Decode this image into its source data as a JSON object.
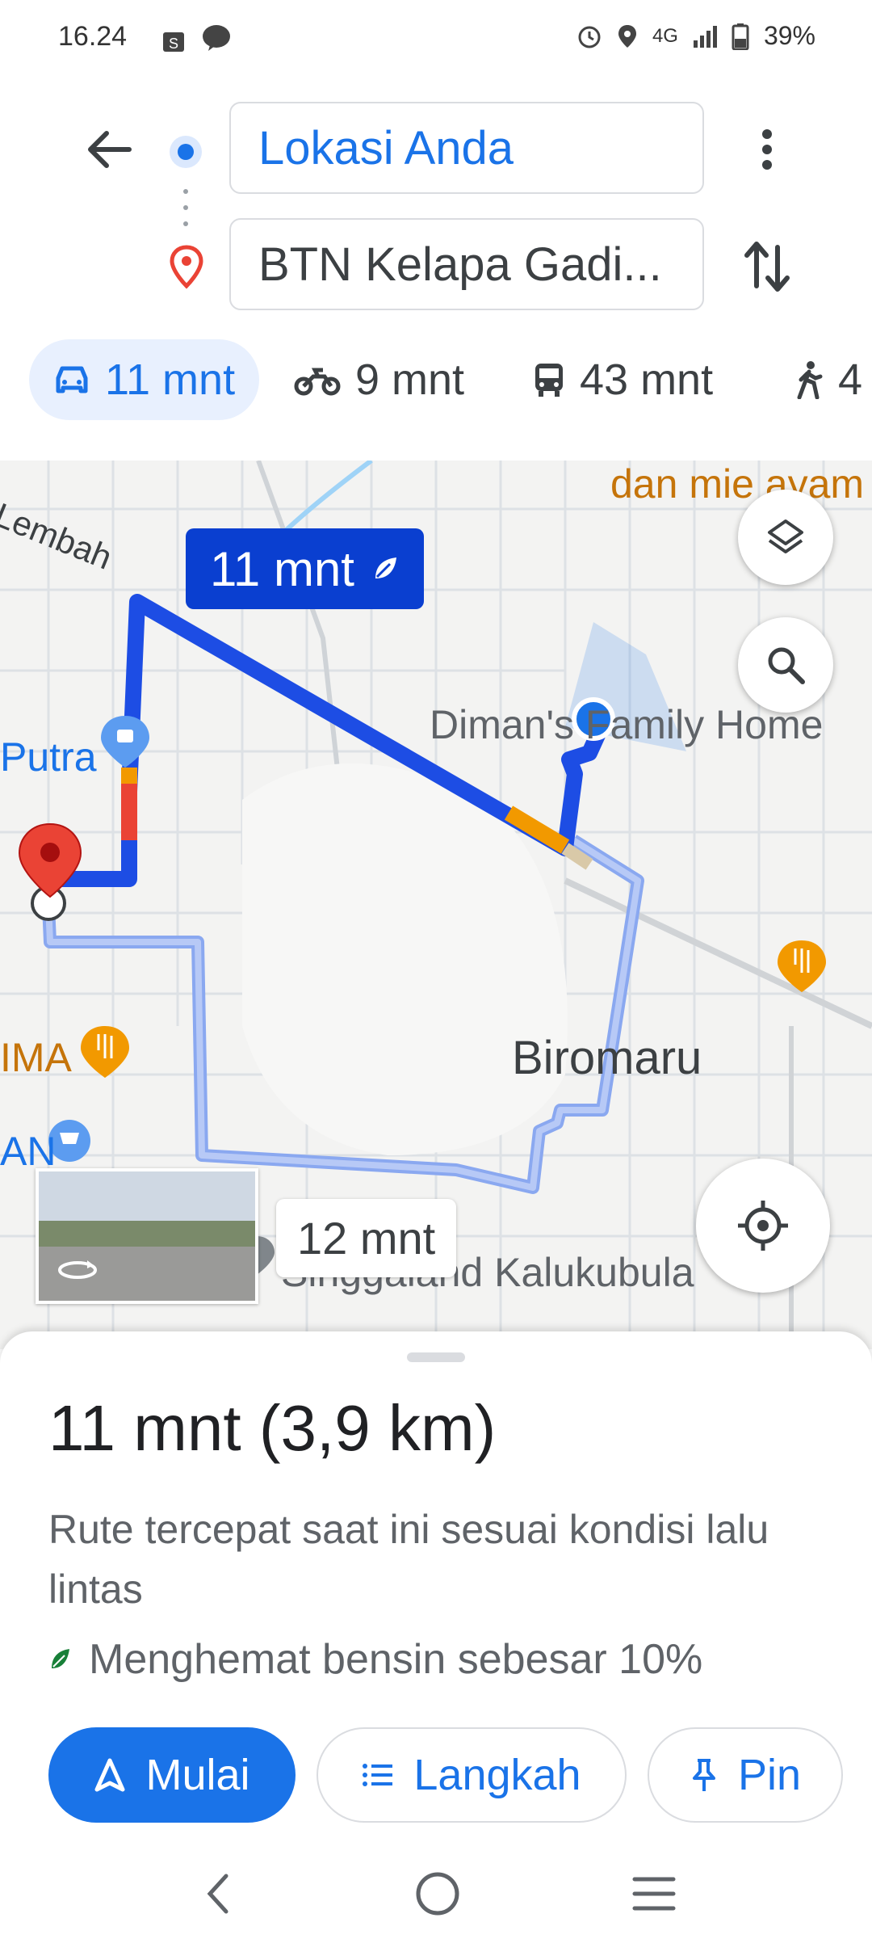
{
  "status_bar": {
    "time": "16.24",
    "network": "4G",
    "battery": "39%"
  },
  "search": {
    "origin": "Lokasi Anda",
    "destination": "BTN Kelapa Gadi..."
  },
  "modes": [
    {
      "label": "11 mnt",
      "icon": "car-icon",
      "active": true
    },
    {
      "label": "9 mnt",
      "icon": "motorcycle-icon",
      "active": false
    },
    {
      "label": "43 mnt",
      "icon": "transit-icon",
      "active": false
    },
    {
      "label": "4",
      "icon": "walk-icon",
      "active": false
    }
  ],
  "map": {
    "labels": {
      "food": "dan mie ayam",
      "lembah": "Lembah",
      "putra": "Putra",
      "home": "Diman's Family Home",
      "ima": "IMA",
      "an": "AN",
      "biromaru": "Biromaru",
      "kalukubula": "Singgaland Kalukubula"
    },
    "route_time": "11 mnt",
    "alt_route_time": "12 mnt"
  },
  "sheet": {
    "summary": "11 mnt (3,9 km)",
    "description": "Rute tercepat saat ini sesuai kondisi lalu lintas",
    "eco": "Menghemat bensin sebesar 10%",
    "buttons": {
      "start": "Mulai",
      "steps": "Langkah",
      "pin": "Pin"
    }
  },
  "colors": {
    "blue": "#1a73e8",
    "route": "#1d4de4",
    "alt_route": "#8aa8f0",
    "pin_red": "#ea4335",
    "orange": "#f29900"
  }
}
